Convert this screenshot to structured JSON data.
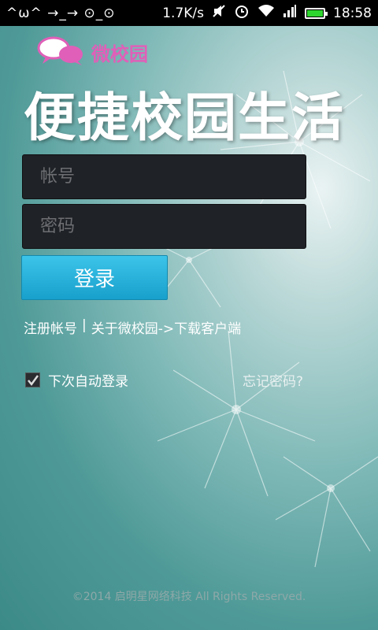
{
  "status_bar": {
    "left_text": "^ω^ →_→ ⊙_⊙",
    "speed": "1.7K/s",
    "time": "18:58",
    "battery_color": "#2fd52f"
  },
  "logo": {
    "text": "微校园",
    "icon": "chat-bubbles-icon",
    "color": "#e05fb8"
  },
  "headline": "便捷校园生活",
  "form": {
    "account_placeholder": "帐号",
    "password_placeholder": "密码",
    "login_label": "登录",
    "accent_color": "#1fa8d4"
  },
  "links": {
    "register": "注册帐号",
    "separator": "|",
    "about": "关于微校园->下载客户端"
  },
  "auto_login": {
    "label": "下次自动登录",
    "checked": true
  },
  "forgot_password": "忘记密码?",
  "footer": "©2014 启明星网络科技 All Rights Reserved."
}
